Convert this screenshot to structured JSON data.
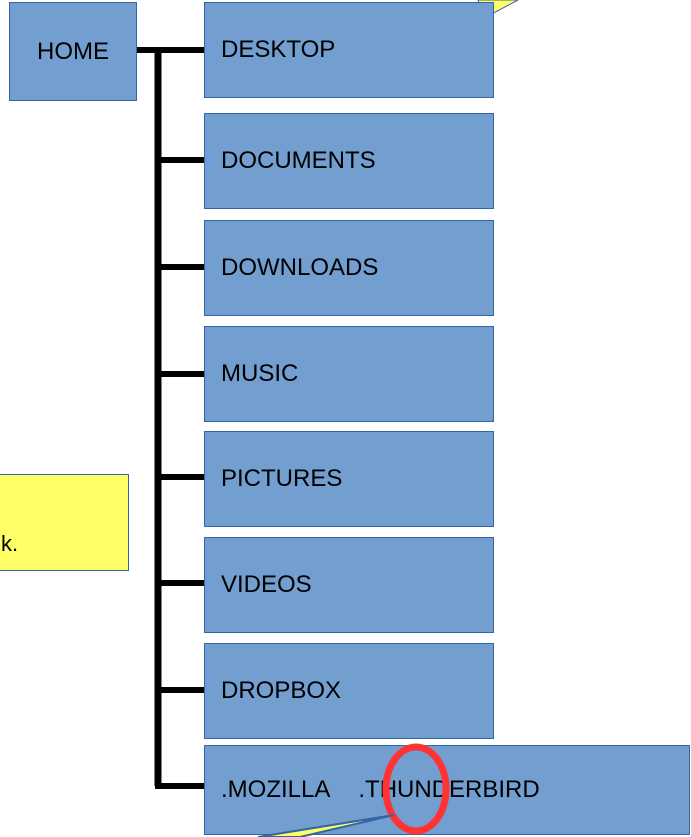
{
  "root": {
    "label": "HOME"
  },
  "folders": [
    {
      "label": "DESKTOP"
    },
    {
      "label": "DOCUMENTS"
    },
    {
      "label": "DOWNLOADS"
    },
    {
      "label": "MUSIC"
    },
    {
      "label": "PICTURES"
    },
    {
      "label": "VIDEOS"
    },
    {
      "label": "DROPBOX"
    }
  ],
  "last_row": {
    "left_label": ".MOZILLA",
    "right_label": ".THUNDERBIRD"
  },
  "callout_left": {
    "text_fragment": "k."
  },
  "colors": {
    "box_fill": "#729fcf",
    "box_border": "#3465a4",
    "connector": "#000000",
    "callout_fill": "#ffff66",
    "highlight_circle": "#ff3333"
  }
}
